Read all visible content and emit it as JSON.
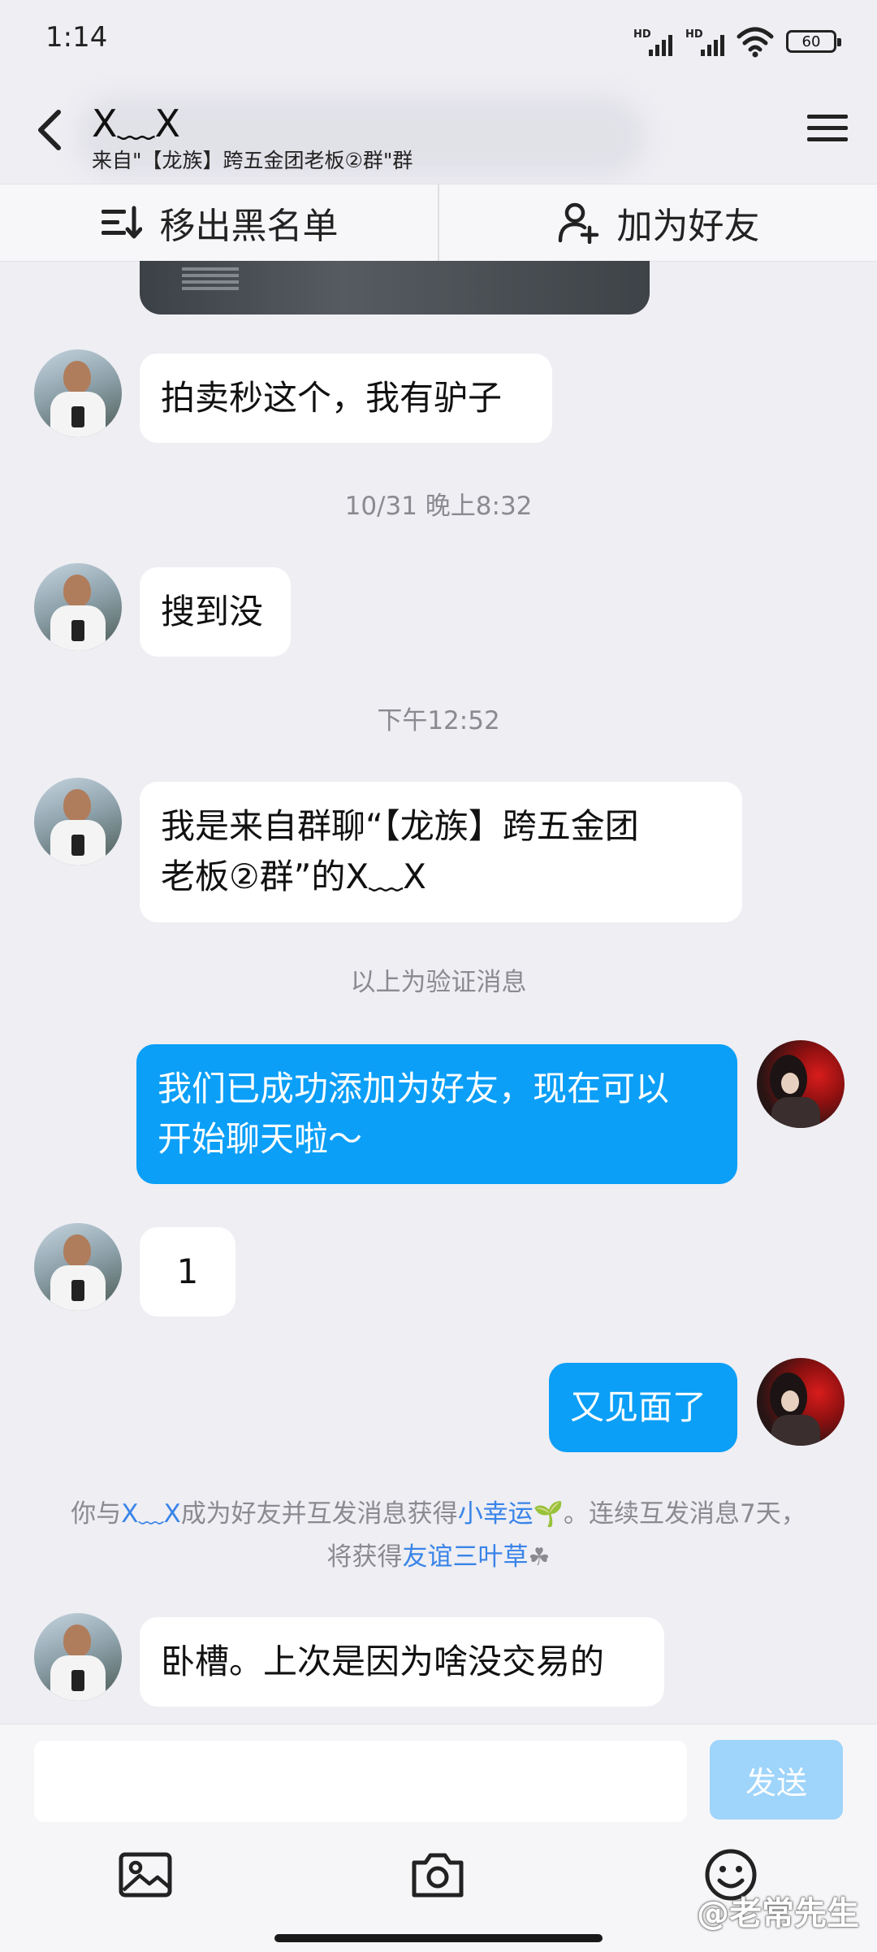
{
  "status": {
    "time": "1:14",
    "signal1_label": "HD",
    "signal2_label": "HD",
    "battery": "60"
  },
  "header": {
    "title": "X﹏X",
    "subtitle": "来自\"【龙族】跨五金团老板②群\"群",
    "back_icon": "chevron-left-icon",
    "menu_icon": "hamburger-menu-icon"
  },
  "actions": {
    "remove_blacklist": "移出黑名单",
    "add_friend": "加为好友"
  },
  "messages": [
    {
      "side": "in",
      "text": "拍卖秒这个，我有驴子"
    },
    {
      "type": "time",
      "text": "10/31 晚上8:32"
    },
    {
      "side": "in",
      "text": "搜到没"
    },
    {
      "type": "time",
      "text": "下午12:52"
    },
    {
      "side": "in",
      "line1": "我是来自群聊“【龙族】跨五金团",
      "line2": "老板②群”的X﹏X"
    },
    {
      "type": "system",
      "text": "以上为验证消息"
    },
    {
      "side": "out",
      "line1": "我们已成功添加为好友，现在可以",
      "line2": "开始聊天啦～"
    },
    {
      "side": "in",
      "text": "1"
    },
    {
      "side": "out",
      "text": "又见面了"
    },
    {
      "side": "in",
      "text": "卧槽。上次是因为啥没交易的"
    }
  ],
  "friend_notice": {
    "p1": "你与",
    "name": "X﹏X",
    "p2": "成为好友并互发消息获得",
    "link1": "小幸运",
    "p3": "。连续互发消息7天，",
    "p4": "将获得",
    "link2": "友谊三叶草"
  },
  "input": {
    "placeholder": "",
    "value": "",
    "send_label": "发送"
  },
  "toolbar": {
    "icons": [
      "image-icon",
      "camera-icon",
      "emoji-icon"
    ]
  },
  "watermark": "@老常先生",
  "colors": {
    "accent": "#0b9ff7",
    "send_disabled": "#9fd4fb",
    "link": "#3a84e8",
    "background": "#eeeef3"
  }
}
